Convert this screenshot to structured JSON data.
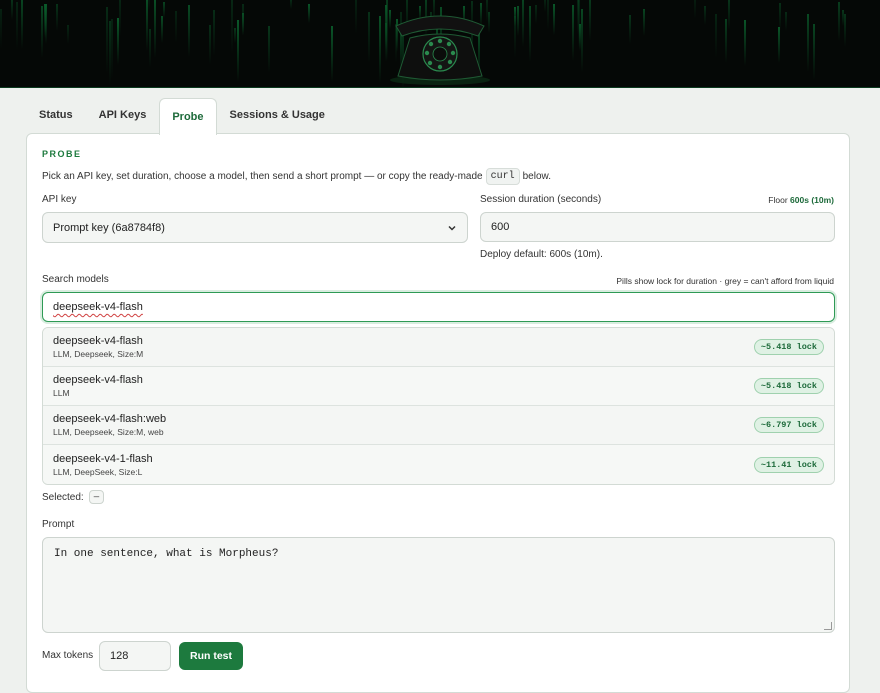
{
  "tabs": [
    {
      "label": "Status"
    },
    {
      "label": "API Keys"
    },
    {
      "label": "Probe",
      "active": true
    },
    {
      "label": "Sessions & Usage"
    }
  ],
  "probe": {
    "section_title": "PROBE",
    "intro_before": "Pick an API key, set duration, choose a model, then send a short prompt — or copy the ready-made",
    "intro_code": "curl",
    "intro_after": "below.",
    "api_key_label": "API key",
    "api_key_value": "Prompt key (6a8784f8)",
    "duration_label": "Session duration (seconds)",
    "floor_prefix": "Floor",
    "floor_value": "600s (10m)",
    "duration_value": "600",
    "deploy_default": "Deploy default: 600s (10m).",
    "search_label": "Search models",
    "search_hint": "Pills show lock for duration · grey = can't afford from liquid",
    "search_value": "deepseek-v4-flash",
    "results": [
      {
        "name": "deepseek-v4-flash",
        "meta": "LLM, Deepseek, Size:M",
        "lock": "~5.418 lock"
      },
      {
        "name": "deepseek-v4-flash",
        "meta": "LLM",
        "lock": "~5.418 lock"
      },
      {
        "name": "deepseek-v4-flash:web",
        "meta": "LLM, Deepseek, Size:M, web",
        "lock": "~6.797 lock"
      },
      {
        "name": "deepseek-v4-1-flash",
        "meta": "LLM, DeepSeek, Size:L",
        "lock": "~11.41 lock"
      }
    ],
    "selected_label": "Selected:",
    "selected_value": "—",
    "prompt_label": "Prompt",
    "prompt_value": "In one sentence, what is Morpheus?",
    "max_tokens_label": "Max tokens",
    "max_tokens_value": "128",
    "run_label": "Run test"
  },
  "colors": {
    "accent": "#1d7a3e",
    "pill_bg": "#dff1e4",
    "banner_bg": "#050806"
  }
}
